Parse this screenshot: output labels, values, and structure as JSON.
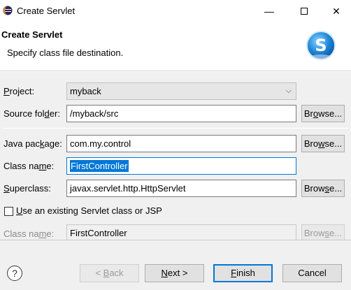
{
  "window": {
    "title": "Create Servlet",
    "minimize": "—",
    "close": "✕"
  },
  "banner": {
    "title": "Create Servlet",
    "description": "Specify class file destination.",
    "logo_letter": "S"
  },
  "form": {
    "project": {
      "label": "Project:",
      "value": "myback"
    },
    "source_folder": {
      "label": "Source folder:",
      "value": "/myback/src",
      "browse": "Browse..."
    },
    "java_package": {
      "label": "Java package:",
      "value": "com.my.control",
      "browse": "Browse..."
    },
    "class_name": {
      "label": "Class name:",
      "value": "FirstController"
    },
    "superclass": {
      "label": "Superclass:",
      "value": "javax.servlet.http.HttpServlet",
      "browse": "Browse..."
    },
    "existing_servlet": {
      "label": "Use an existing Servlet class or JSP",
      "checked": false
    },
    "existing_class_name": {
      "label": "Class name:",
      "value": "FirstController",
      "browse": "Browse..."
    }
  },
  "footer": {
    "help": "?",
    "back": "< Back",
    "next": "Next >",
    "finish": "Finish",
    "cancel": "Cancel"
  },
  "colors": {
    "accent": "#0078d7",
    "dialog_bg": "#f0f0f0"
  }
}
